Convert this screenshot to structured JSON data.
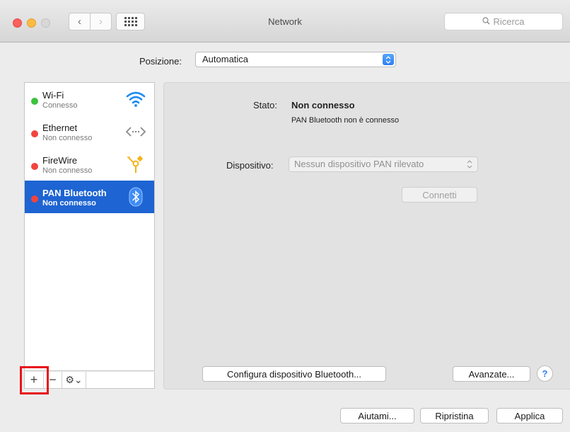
{
  "window": {
    "title": "Network",
    "search_placeholder": "Ricerca",
    "nav_back": "‹",
    "nav_forward": "›"
  },
  "location": {
    "label": "Posizione:",
    "value": "Automatica"
  },
  "services": [
    {
      "name": "Wi-Fi",
      "status": "Connesso",
      "state_color": "#3cc23e",
      "icon": "wifi-icon",
      "selected": false
    },
    {
      "name": "Ethernet",
      "status": "Non connesso",
      "state_color": "#f2443f",
      "icon": "ethernet-icon",
      "selected": false
    },
    {
      "name": "FireWire",
      "status": "Non connesso",
      "state_color": "#f2443f",
      "icon": "firewire-icon",
      "selected": false
    },
    {
      "name": "PAN Bluetooth",
      "status": "Non connesso",
      "state_color": "#f2443f",
      "icon": "bluetooth-icon",
      "selected": true
    }
  ],
  "list_toolbar": {
    "add": "+",
    "remove": "−",
    "gear": "⚙⌄"
  },
  "detail": {
    "state_label": "Stato:",
    "state_value": "Non connesso",
    "state_description": "PAN Bluetooth non è connesso",
    "device_label": "Dispositivo:",
    "device_value": "Nessun dispositivo PAN rilevato",
    "connect_button": "Connetti",
    "configure_button": "Configura dispositivo Bluetooth...",
    "advanced_button": "Avanzate...",
    "help": "?"
  },
  "footer": {
    "assist_button": "Aiutami...",
    "revert_button": "Ripristina",
    "apply_button": "Applica"
  },
  "colors": {
    "selection": "#1e64d2",
    "highlight_box": "#e8141c",
    "accent": "#2f7ff6"
  }
}
